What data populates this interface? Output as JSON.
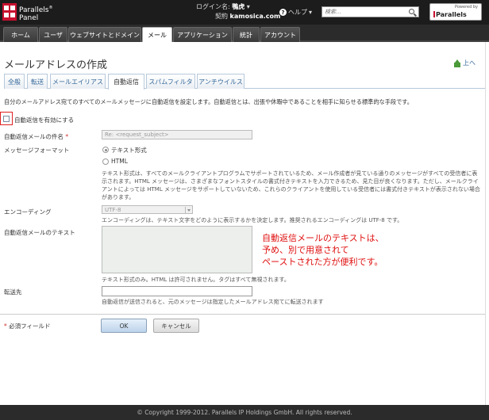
{
  "header": {
    "logo": {
      "brand": "Parallels",
      "product": "Panel",
      "reg": "®"
    },
    "login": {
      "prefix": "ログイン名:",
      "user": "鴨虎",
      "contract_prefix": "契約",
      "contract": "kamosica.com"
    },
    "help_label": "ヘルプ",
    "search_placeholder": "検索...",
    "powered_by": "Powered by",
    "powered_brand": "Parallels"
  },
  "nav": {
    "tabs": [
      "ホーム",
      "ユーザ",
      "ウェブサイトとドメイン",
      "メール",
      "アプリケーション",
      "統計",
      "アカウント"
    ],
    "active_index": 3
  },
  "page": {
    "title": "メールアドレスの作成",
    "up_link": "上へ"
  },
  "subtabs": {
    "items": [
      "全般",
      "転送",
      "メールエイリアス",
      "自動返信",
      "スパムフィルタ",
      "アンチウイルス"
    ],
    "active_index": 3
  },
  "form": {
    "description": "自分のメールアドレス宛てのすべてのメールメッセージに自動返信を設定します。自動返信とは、出張や休暇中であることを相手に知らせる標準的な手段です。",
    "enable_label": "自動返信を有効にする",
    "enable_checked": false,
    "subject_label": "自動返信メールの件名",
    "required_mark": "*",
    "subject_value": "Re: <request_subject>",
    "format_label": "メッセージフォーマット",
    "format_options": [
      "テキスト形式",
      "HTML"
    ],
    "format_selected": 0,
    "format_hint": "テキスト形式は、すべてのメールクライアントプログラムでサポートされているため、メール作成者が見ている通りのメッセージがすべての受信者に表示されます。HTML メッセージは、さまざまなフォントスタイルの書式付きテキストを入力できるため、見た目が良くなります。ただし、メールクライアントによっては HTML メッセージをサポートしていないため、これらのクライアントを使用している受信者には書式付きテキストが表示されない場合があります。",
    "encoding_label": "エンコーディング",
    "encoding_value": "UTF-8",
    "encoding_hint": "エンコーディングは、テキスト文字をどのように表示するかを決定します。推奨されるエンコーディングは UTF-8 です。",
    "text_label": "自動返信メールのテキスト",
    "text_hint": "テキスト形式のみ。HTML は許可されません。タグはすべて無視されます。",
    "forward_label": "転送先",
    "forward_value": "",
    "forward_hint": "自動返信が送信されると、元のメッセージは指定したメールアドレス宛てに転送されます",
    "required_note": "必須フィールド",
    "ok_label": "OK",
    "cancel_label": "キャンセル"
  },
  "annotation": {
    "lines": [
      "自動返信メールのテキストは、",
      "予め、別で用意されて",
      "ペーストされた方が便利です。"
    ],
    "color": "#e01010"
  },
  "footer": {
    "copyright": "© Copyright 1999-2012. Parallels IP Holdings GmbH. All rights reserved."
  }
}
